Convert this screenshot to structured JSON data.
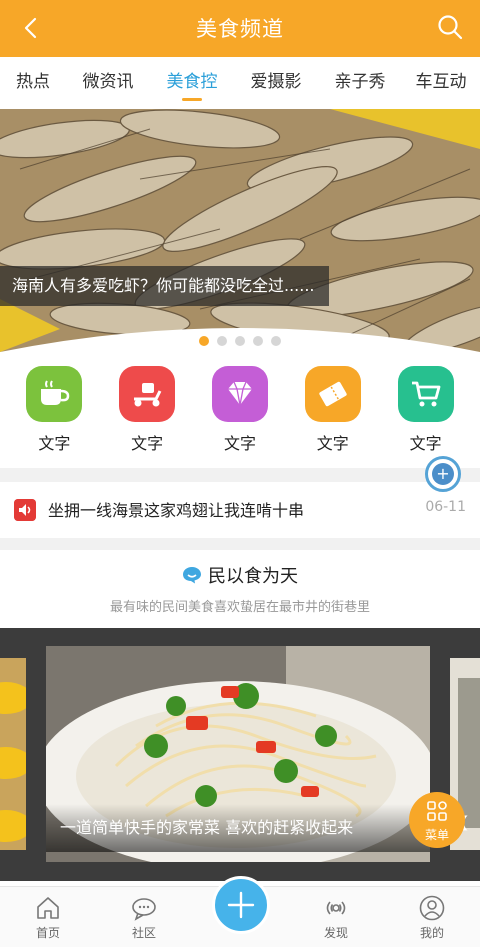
{
  "header": {
    "title": "美食频道",
    "back_icon": "chevron-left-icon",
    "search_icon": "search-icon",
    "color": "#f7a728"
  },
  "tabs": [
    {
      "label": "热点",
      "active": false
    },
    {
      "label": "微资讯",
      "active": false
    },
    {
      "label": "美食控",
      "active": true
    },
    {
      "label": "爱摄影",
      "active": false
    },
    {
      "label": "亲子秀",
      "active": false
    },
    {
      "label": "车互动",
      "active": false
    }
  ],
  "banner": {
    "caption": "海南人有多爱吃虾？你可能都没吃全过......",
    "slides": 5,
    "active_slide": 1
  },
  "quick_icons": [
    {
      "label": "文字",
      "icon": "cup-icon",
      "color": "#7cc23d"
    },
    {
      "label": "文字",
      "icon": "delivery-scooter-icon",
      "color": "#ee4b4b"
    },
    {
      "label": "文字",
      "icon": "diamond-icon",
      "color": "#c45ed6"
    },
    {
      "label": "文字",
      "icon": "ticket-icon",
      "color": "#f7a728"
    },
    {
      "label": "文字",
      "icon": "cart-icon",
      "color": "#27c08f"
    }
  ],
  "notice": {
    "text": "坐拥一线海景这家鸡翅让我连啃十串",
    "date": "06-11",
    "icon": "speaker-icon"
  },
  "section": {
    "title": "民以食为天",
    "subtitle": "最有味的民间美食喜欢蛰居在最市井的街巷里",
    "icon": "chat-bubble-icon"
  },
  "carousel": {
    "caption": "一道简单快手的家常菜 喜欢的赶紧收起来",
    "right_peek": "【"
  },
  "menu_button": {
    "label": "菜单",
    "icon": "grid-icon"
  },
  "bottom_nav": [
    {
      "label": "首页",
      "icon": "home-icon"
    },
    {
      "label": "社区",
      "icon": "chat-icon"
    },
    {
      "label": "发现",
      "icon": "broadcast-icon"
    },
    {
      "label": "我的",
      "icon": "user-icon"
    }
  ],
  "fab": {
    "icon": "plus-icon",
    "color": "#46b3ea"
  }
}
